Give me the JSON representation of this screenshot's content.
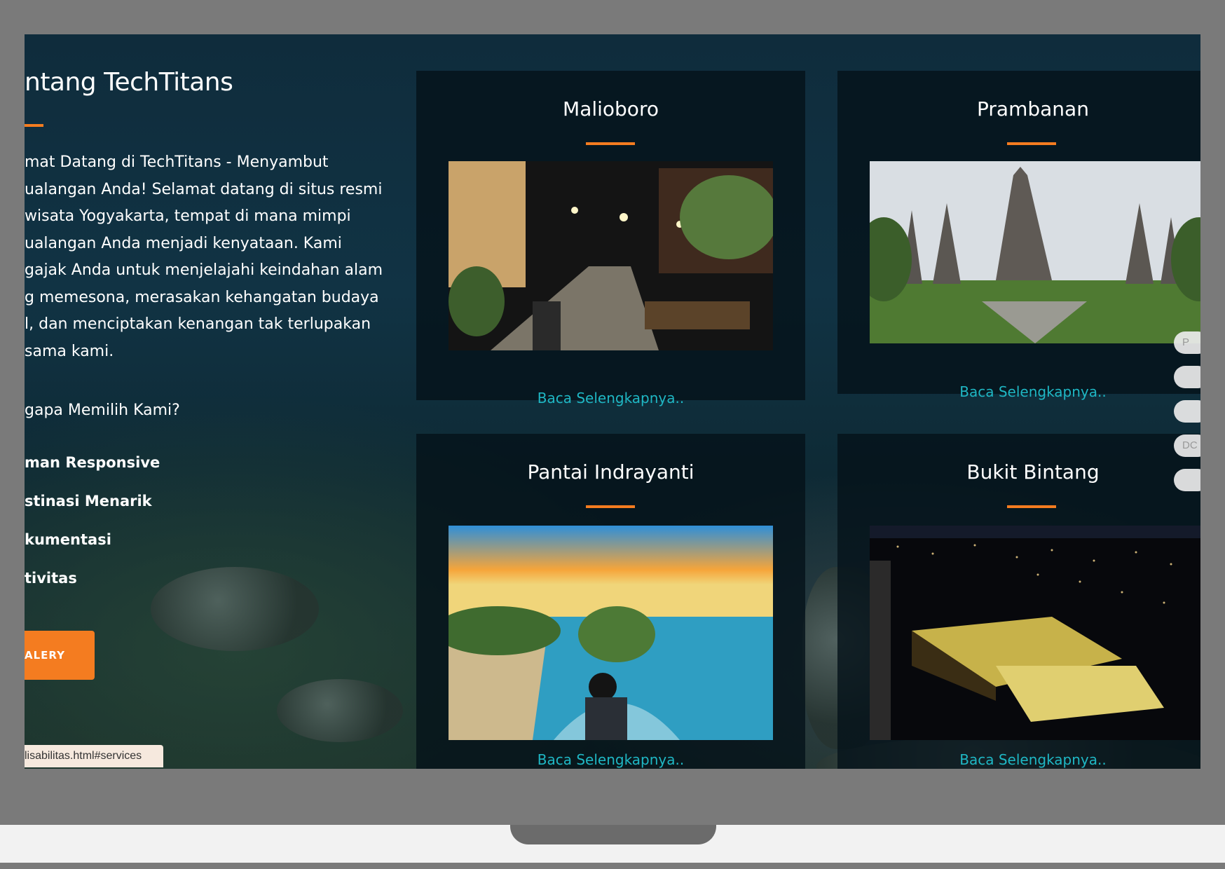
{
  "about": {
    "title": "ntang TechTitans",
    "intro": "mat Datang di TechTitans - Menyambut\nualangan Anda! Selamat datang di situs resmi\nwisata Yogyakarta, tempat di mana mimpi\nualangan Anda menjadi kenyataan. Kami\ngajak Anda untuk menjelajahi keindahan alam\ng memesona, merasakan kehangatan budaya\nl, dan menciptakan kenangan tak terlupakan\nsama kami.",
    "why_title": "gapa Memilih Kami?",
    "features": [
      "man Responsive",
      "stinasi Menarik",
      "kumentasi",
      "tivitas"
    ],
    "button_label": "ALERY"
  },
  "status_url": "lisabilitas.html#services",
  "cards": [
    {
      "title": "Malioboro",
      "link": "Baca Selengkapnya.."
    },
    {
      "title": "Prambanan",
      "link": "Baca Selengkapnya.."
    },
    {
      "title": "Pantai Indrayanti",
      "link": "Baca Selengkapnya.."
    },
    {
      "title": "Bukit Bintang",
      "link": "Baca Selengkapnya.."
    }
  ],
  "side_pills": [
    "P",
    "",
    "",
    "DC",
    ""
  ],
  "colors": {
    "accent": "#f47c20",
    "link": "#1fb7c4",
    "card_bg": "#05121a"
  }
}
